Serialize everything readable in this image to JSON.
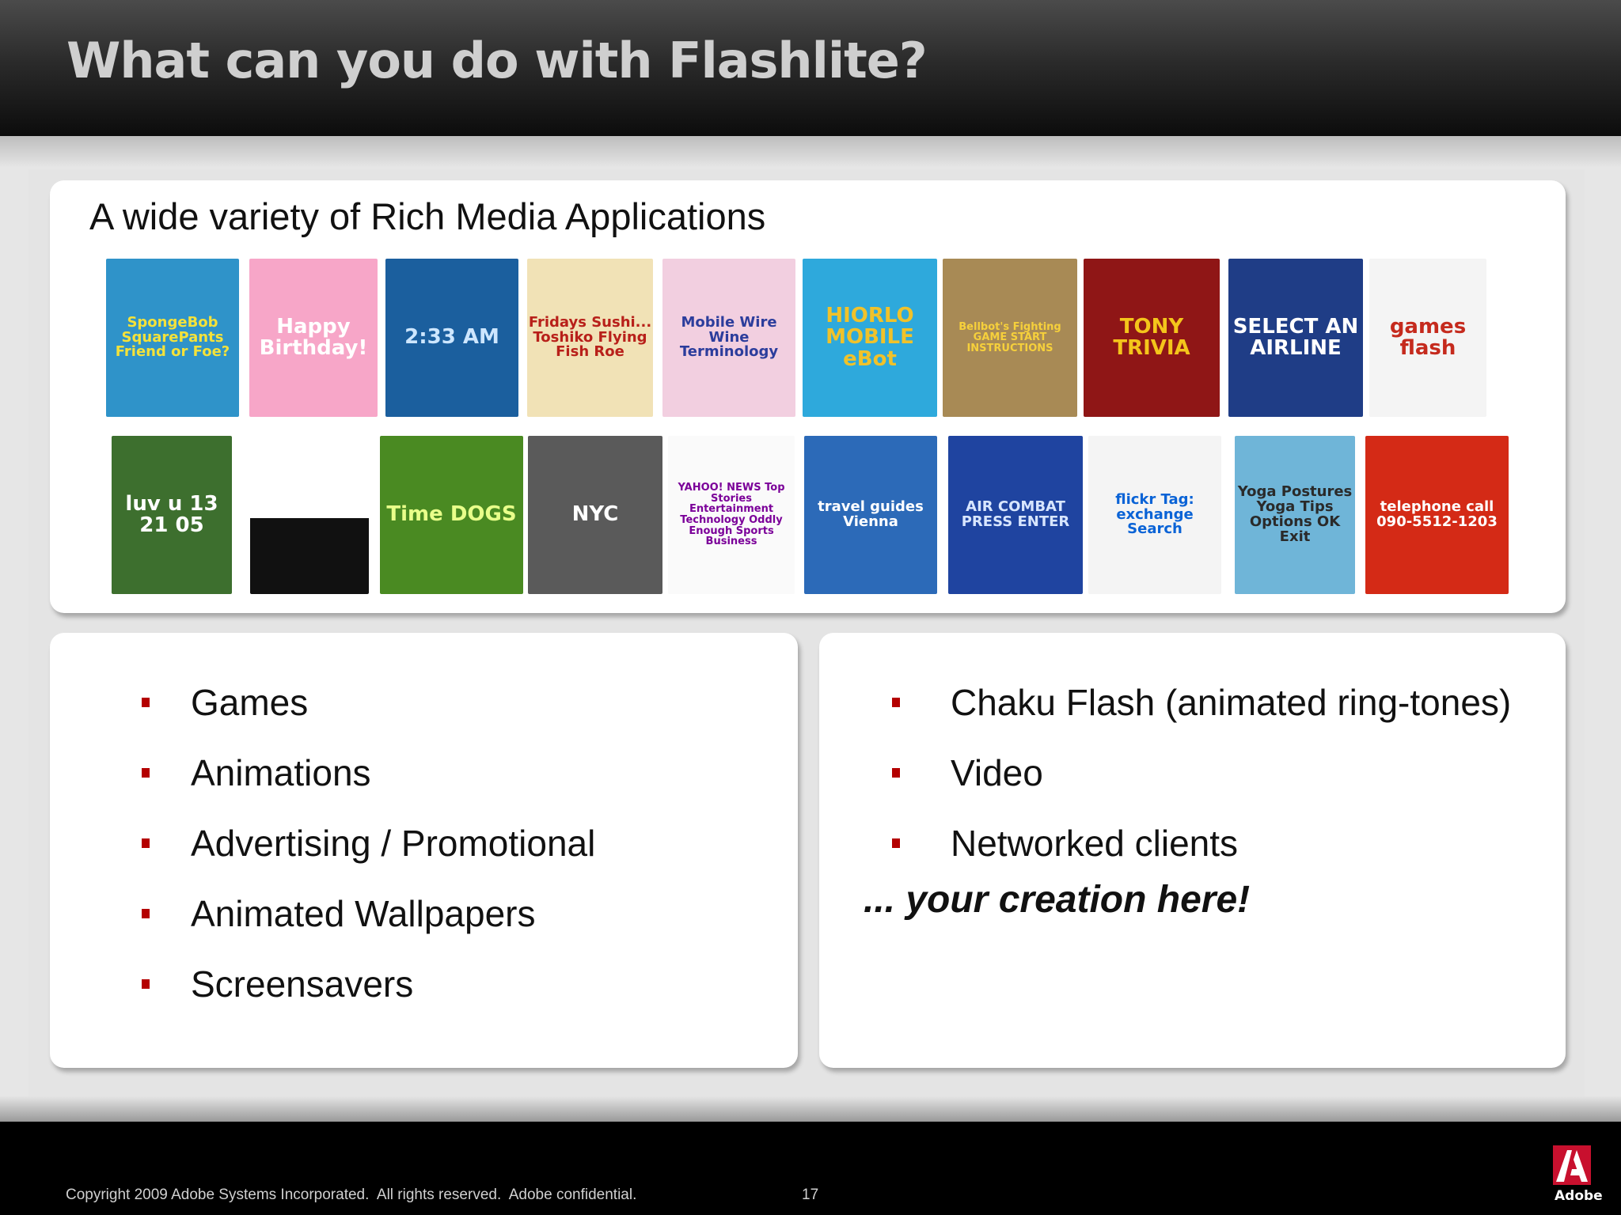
{
  "slide": {
    "title": "What can you do with Flashlite?"
  },
  "top_panel": {
    "heading": "A wide variety of Rich Media Applications",
    "thumbnails": [
      {
        "label": "SpongeBob SquarePants Friend or Foe?",
        "bg": "#2f93c9",
        "fg": "#f4e23a"
      },
      {
        "label": "Happy Birthday!",
        "bg": "#f7a6c8",
        "fg": "#ffffff"
      },
      {
        "label": "2:33 AM",
        "bg": "#1b5f9e",
        "fg": "#cde6ff"
      },
      {
        "label": "Fridays Sushi... Toshiko Flying Fish Roe",
        "bg": "#f1e2b6",
        "fg": "#b8201a"
      },
      {
        "label": "Mobile Wire Wine Terminology",
        "bg": "#f2cfe0",
        "fg": "#2c3d9c"
      },
      {
        "label": "HIORLO MOBILE eBot",
        "bg": "#2ea9dc",
        "fg": "#f0c22a"
      },
      {
        "label": "Bellbot's Fighting GAME START INSTRUCTIONS",
        "bg": "#a88a55",
        "fg": "#f6d03b"
      },
      {
        "label": "TONY TRIVIA",
        "bg": "#8f1616",
        "fg": "#f4c51b"
      },
      {
        "label": "SELECT AN AIRLINE",
        "bg": "#1f3d86",
        "fg": "#ffffff"
      },
      {
        "label": "games flash",
        "bg": "#f4f4f4",
        "fg": "#c52a1d"
      },
      {
        "label": "luv u 13 21 05",
        "bg": "#3d6f2e",
        "fg": "#ffffff"
      },
      {
        "label": "",
        "bg": "#111111",
        "fg": "#ffffff"
      },
      {
        "label": "Time DOGS",
        "bg": "#4a8a22",
        "fg": "#e9ff8a"
      },
      {
        "label": "NYC",
        "bg": "#5a5a5a",
        "fg": "#ffffff"
      },
      {
        "label": "YAHOO! NEWS Top Stories Entertainment Technology Oddly Enough Sports Business",
        "bg": "#fafafa",
        "fg": "#7b0099"
      },
      {
        "label": "travel guides Vienna",
        "bg": "#2c6ab8",
        "fg": "#ffffff"
      },
      {
        "label": "AIR COMBAT PRESS ENTER",
        "bg": "#1f44a0",
        "fg": "#d8e6ff"
      },
      {
        "label": "flickr Tag: exchange Search",
        "bg": "#f4f4f4",
        "fg": "#0a63d6"
      },
      {
        "label": "Yoga Postures Yoga Tips Options OK Exit",
        "bg": "#6fb5d8",
        "fg": "#2a2a2a"
      },
      {
        "label": "telephone call 090-5512-1203",
        "bg": "#d42a16",
        "fg": "#ffffff"
      }
    ]
  },
  "left_panel": {
    "items": [
      "Games",
      "Animations",
      "Advertising / Promotional",
      "Animated Wallpapers",
      "Screensavers"
    ]
  },
  "right_panel": {
    "items": [
      "Chaku Flash (animated ring-tones)",
      "Video",
      "Networked clients"
    ],
    "tagline": "... your creation here!"
  },
  "footer": {
    "copyright": "Copyright 2009 Adobe Systems Incorporated.  All rights reserved.  Adobe confidential.",
    "page_number": "17",
    "brand": "Adobe"
  },
  "colors": {
    "bullet": "#b40000",
    "adobe_red": "#c8102e"
  }
}
